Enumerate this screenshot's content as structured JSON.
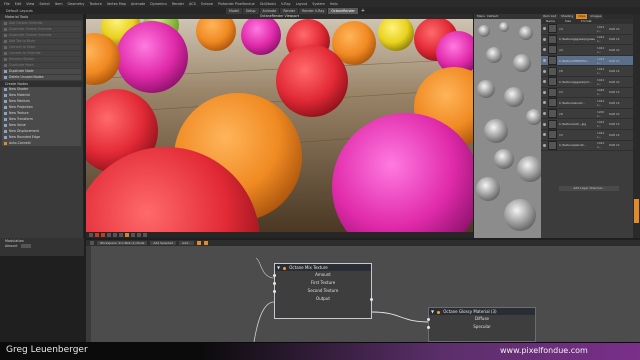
{
  "menubar": [
    "File",
    "Edit",
    "View",
    "Select",
    "Item",
    "Geometry",
    "Texture",
    "Vertex Map",
    "Animate",
    "Dynamics",
    "Render",
    "ACS",
    "Octane",
    "Pixfonder Pixelfondue",
    "Skill/tools",
    "V-Ray",
    "Layout",
    "System",
    "Help"
  ],
  "layout_selector": "Default Layouts",
  "tabs": [
    {
      "label": "Model",
      "active": false
    },
    {
      "label": "Setup",
      "active": false
    },
    {
      "label": "Animate",
      "active": false
    },
    {
      "label": "Render",
      "active": false
    },
    {
      "label": "Render V-Ray",
      "active": false
    },
    {
      "label": "OctaneRender",
      "active": true
    }
  ],
  "left_panel": {
    "title": "Material Tools",
    "buttons": [
      {
        "label": "Add Octane Override",
        "dim": true
      },
      {
        "label": "Duplicate Octane Override",
        "dim": true
      },
      {
        "label": "Duplicate Octane Override",
        "dim": true
      },
      {
        "label": "Add Tex to Mixer",
        "dim": true
      },
      {
        "label": "Convert to Mixer",
        "dim": true
      },
      {
        "label": "Convert to Override",
        "dim": true
      },
      {
        "label": "Rename Shader",
        "dim": true
      },
      {
        "label": "Duplicate Mesh",
        "dim": true
      },
      {
        "label": "Duplicate Node",
        "dim": false
      },
      {
        "label": "Delete Unused Nodes",
        "dim": false
      }
    ],
    "create_title": "Create Nodes",
    "create_buttons": [
      {
        "label": "New Shader"
      },
      {
        "label": "New Material"
      },
      {
        "label": "New Medium"
      },
      {
        "label": "New Projection"
      },
      {
        "label": "New Texture"
      },
      {
        "label": "New Transform"
      },
      {
        "label": "New Value"
      },
      {
        "label": "New Displacement"
      },
      {
        "label": "New Rounded Edge"
      }
    ],
    "auto_connect": "Auto-Connect"
  },
  "modifier": {
    "title": "Modulation",
    "amount_label": "Amount"
  },
  "viewport": {
    "title": "OctaneRender Viewport"
  },
  "right_view": {
    "tabs": [
      "Menu",
      "Default"
    ]
  },
  "item_list": {
    "tabs": [
      "Item List",
      "Shading",
      "Clips",
      "Images"
    ],
    "active_tab": "Clips",
    "header": [
      "Name",
      "Size",
      "Format"
    ],
    "rows": [
      {
        "label": "(1)",
        "size": "1024 x...",
        "fmt": "RGB 24",
        "sel": false
      },
      {
        "label": "C:/texture/jpg/warp/grass/N...",
        "size": "1024 x...",
        "fmt": "RGB 24",
        "sel": false
      },
      {
        "label": "(2)",
        "size": "1024 x...",
        "fmt": "RGB 24",
        "sel": false
      },
      {
        "label": "C:/texture/HDR/Fkkr...",
        "size": "1024 x...",
        "fmt": "RGB 24",
        "sel": true
      },
      {
        "label": "(3)",
        "size": "1024 x...",
        "fmt": "RGB 24",
        "sel": false
      },
      {
        "label": "C:/texture/jpg/warp/d...",
        "size": "1024 x...",
        "fmt": "RGB 24",
        "sel": false
      },
      {
        "label": "(1)",
        "size": "2048 x...",
        "fmt": "RGB 24",
        "sel": false
      },
      {
        "label": "C:/texture/wood/...",
        "size": "1024 x...",
        "fmt": "RGB 24",
        "sel": false
      },
      {
        "label": "(3)",
        "size": "1200 x...",
        "fmt": "RGB 24",
        "sel": false
      },
      {
        "label": "C:/texture/old/...jpg",
        "size": "1024 x...",
        "fmt": "RGB 24",
        "sel": false
      },
      {
        "label": "(1)",
        "size": "1024 x...",
        "fmt": "RGB 24",
        "sel": false
      },
      {
        "label": "C:/texture/plain/0...",
        "size": "1024 x...",
        "fmt": "RGB 24",
        "sel": false
      }
    ],
    "add_layer": "Add Layer Channel..."
  },
  "node_editor": {
    "workspace": "Workspace: Scn:Ball (1) Node",
    "add_selected": "Add Selected",
    "add": "Add..."
  },
  "nodes": {
    "mix": {
      "title": "Octane Mix Texture",
      "ports": [
        "Amount",
        "First Texture",
        "Second Texture",
        "Output"
      ]
    },
    "glossy": {
      "title": "Octane Glossy Material (3)",
      "ports": [
        "Diffuse",
        "Specular"
      ]
    }
  },
  "footer": {
    "presenter": "Greg Leuenberger",
    "site": "www.pixelfondue.com"
  },
  "colors": {
    "accent_orange": "#e08a2a",
    "footer_purple": "#7a2f8a",
    "selection_blue": "#5b6e8a"
  }
}
